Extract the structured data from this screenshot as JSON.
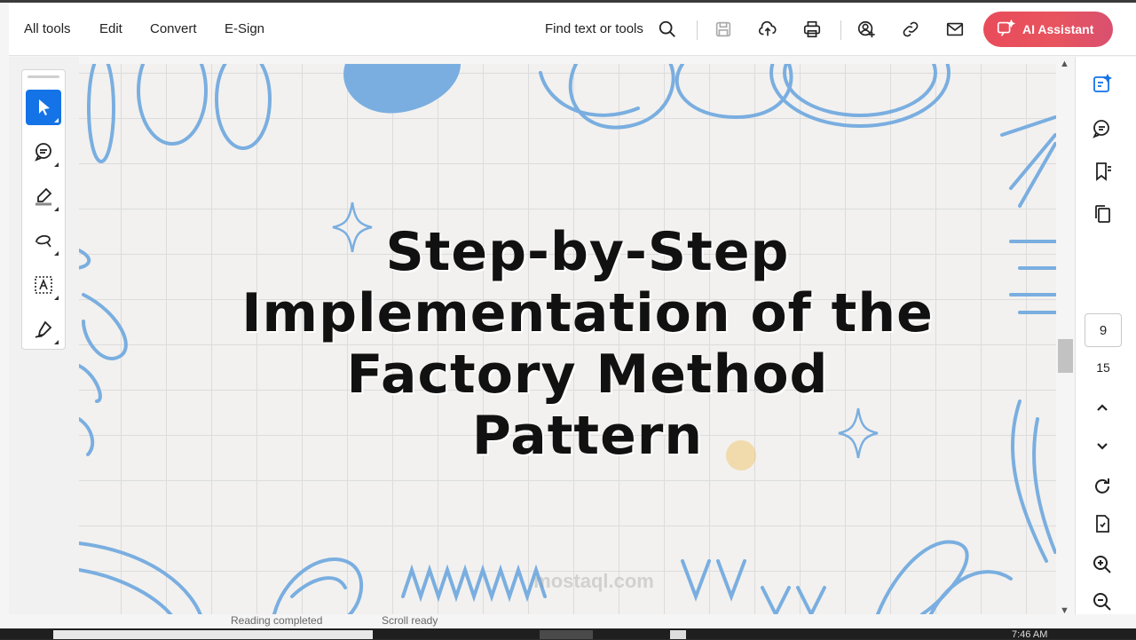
{
  "menu": {
    "items": [
      "All tools",
      "Edit",
      "Convert",
      "E-Sign"
    ],
    "find_label": "Find text or tools",
    "ai_label": "AI Assistant"
  },
  "toolbar_icons": [
    "search-icon",
    "save-icon",
    "upload-icon",
    "print-icon",
    "share-user-icon",
    "link-icon",
    "mail-icon"
  ],
  "left_tools": [
    "select-tool",
    "comment-tool",
    "highlight-tool",
    "draw-tool",
    "text-field-tool",
    "sign-tool"
  ],
  "document": {
    "title_lines": [
      "Step-by-Step",
      "Implementation of the",
      "Factory Method",
      "Pattern"
    ],
    "watermark": "mostaql.com"
  },
  "right_rail": {
    "icons": [
      "edit-pdf-icon",
      "comments-icon",
      "bookmark-icon",
      "pages-icon"
    ],
    "current_page": "9",
    "total_pages": "15"
  },
  "status": {
    "left": "Reading completed",
    "right": "Scroll ready"
  },
  "taskbar": {
    "clock": "7:46 AM"
  },
  "colors": {
    "accent": "#1473e6",
    "ai_gradient_start": "#e94b5a",
    "doodle_blue": "#7aaee0",
    "doc_background": "#f2f1ef"
  }
}
